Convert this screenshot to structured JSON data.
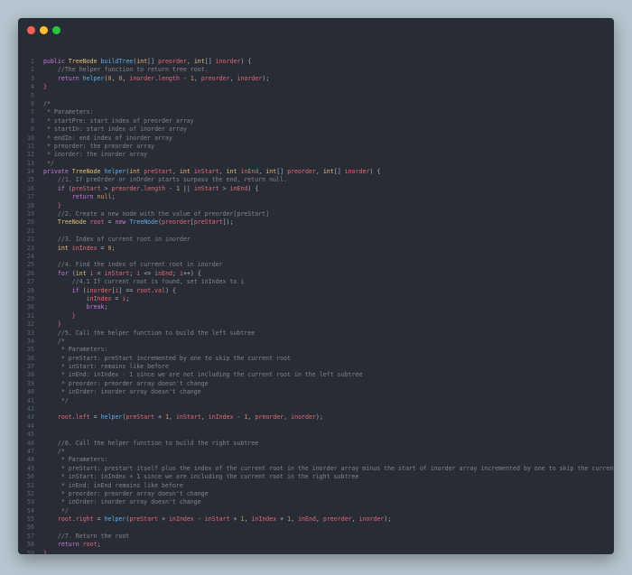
{
  "window": {
    "buttons": {
      "close_color": "#ff5f56",
      "minimize_color": "#ffbd2e",
      "maximize_color": "#27c93f"
    }
  },
  "editor": {
    "language": "java",
    "lines": [
      [
        [
          "kw",
          "public "
        ],
        [
          "ty",
          "TreeNode "
        ],
        [
          "fn",
          "buildTree"
        ],
        [
          "pl",
          "("
        ],
        [
          "ty",
          "int"
        ],
        [
          "pl",
          "[] "
        ],
        [
          "pa",
          "preorder"
        ],
        [
          "pl",
          ", "
        ],
        [
          "ty",
          "int"
        ],
        [
          "pl",
          "[] "
        ],
        [
          "pa",
          "inorder"
        ],
        [
          "pl",
          ") {"
        ]
      ],
      [
        [
          "cm",
          "    //The helper function to return tree root."
        ]
      ],
      [
        [
          "kw",
          "    return "
        ],
        [
          "fn",
          "helper"
        ],
        [
          "pl",
          "("
        ],
        [
          "nu",
          "0"
        ],
        [
          "pl",
          ", "
        ],
        [
          "nu",
          "0"
        ],
        [
          "pl",
          ", "
        ],
        [
          "pa",
          "inorder"
        ],
        [
          "pl",
          "."
        ],
        [
          "pa",
          "length"
        ],
        [
          "pl",
          " - "
        ],
        [
          "nu",
          "1"
        ],
        [
          "pl",
          ", "
        ],
        [
          "pa",
          "preorder"
        ],
        [
          "pl",
          ", "
        ],
        [
          "pa",
          "inorder"
        ],
        [
          "pl",
          ");"
        ]
      ],
      [
        [
          "pa",
          "}"
        ]
      ],
      [],
      [
        [
          "cm",
          "/*"
        ]
      ],
      [
        [
          "cm",
          " * Parameters:"
        ]
      ],
      [
        [
          "cm",
          " * startPre: start index of preorder array"
        ]
      ],
      [
        [
          "cm",
          " * startIn: start index of inorder array"
        ]
      ],
      [
        [
          "cm",
          " * endIn: end index of inorder array"
        ]
      ],
      [
        [
          "cm",
          " * preorder: the preorder array"
        ]
      ],
      [
        [
          "cm",
          " * inorder: the inorder array"
        ]
      ],
      [
        [
          "cm",
          " */"
        ]
      ],
      [
        [
          "kw",
          "private "
        ],
        [
          "ty",
          "TreeNode "
        ],
        [
          "fn",
          "helper"
        ],
        [
          "pl",
          "("
        ],
        [
          "ty",
          "int "
        ],
        [
          "pa",
          "preStart"
        ],
        [
          "pl",
          ", "
        ],
        [
          "ty",
          "int "
        ],
        [
          "pa",
          "inStart"
        ],
        [
          "pl",
          ", "
        ],
        [
          "ty",
          "int "
        ],
        [
          "pa",
          "inEnd"
        ],
        [
          "pl",
          ", "
        ],
        [
          "ty",
          "int"
        ],
        [
          "pl",
          "[] "
        ],
        [
          "pa",
          "preorder"
        ],
        [
          "pl",
          ", "
        ],
        [
          "ty",
          "int"
        ],
        [
          "pl",
          "[] "
        ],
        [
          "pa",
          "inorder"
        ],
        [
          "pl",
          ") {"
        ]
      ],
      [
        [
          "cm",
          "    //1. If preOrder or inOrder starts surpass the end, return null."
        ]
      ],
      [
        [
          "kw",
          "    if "
        ],
        [
          "pl",
          "("
        ],
        [
          "pa",
          "preStart"
        ],
        [
          "pl",
          " > "
        ],
        [
          "pa",
          "preorder"
        ],
        [
          "pl",
          "."
        ],
        [
          "pa",
          "length"
        ],
        [
          "pl",
          " - "
        ],
        [
          "nu",
          "1"
        ],
        [
          "pl",
          " || "
        ],
        [
          "pa",
          "inStart"
        ],
        [
          "pl",
          " > "
        ],
        [
          "pa",
          "inEnd"
        ],
        [
          "pl",
          ") {"
        ]
      ],
      [
        [
          "kw",
          "        return "
        ],
        [
          "nu",
          "null"
        ],
        [
          "pl",
          ";"
        ]
      ],
      [
        [
          "pa",
          "    }"
        ]
      ],
      [
        [
          "cm",
          "    //2. Create a new node with the value of preorder[preStart]"
        ]
      ],
      [
        [
          "ty",
          "    TreeNode "
        ],
        [
          "pa",
          "root"
        ],
        [
          "pl",
          " = "
        ],
        [
          "kw",
          "new "
        ],
        [
          "fn",
          "TreeNode"
        ],
        [
          "pl",
          "("
        ],
        [
          "pa",
          "preorder"
        ],
        [
          "pl",
          "["
        ],
        [
          "pa",
          "preStart"
        ],
        [
          "pl",
          "]);"
        ]
      ],
      [],
      [
        [
          "cm",
          "    //3. Index of current root in inorder"
        ]
      ],
      [
        [
          "ty",
          "    int "
        ],
        [
          "pa",
          "inIndex"
        ],
        [
          "pl",
          " = "
        ],
        [
          "nu",
          "0"
        ],
        [
          "pl",
          ";"
        ]
      ],
      [],
      [
        [
          "cm",
          "    //4. Find the index of current root in inorder"
        ]
      ],
      [
        [
          "kw",
          "    for "
        ],
        [
          "pl",
          "("
        ],
        [
          "ty",
          "int "
        ],
        [
          "pa",
          "i"
        ],
        [
          "pl",
          " = "
        ],
        [
          "pa",
          "inStart"
        ],
        [
          "pl",
          "; "
        ],
        [
          "pa",
          "i"
        ],
        [
          "pl",
          " <= "
        ],
        [
          "pa",
          "inEnd"
        ],
        [
          "pl",
          "; "
        ],
        [
          "pa",
          "i"
        ],
        [
          "pl",
          "++) {"
        ]
      ],
      [
        [
          "cm",
          "        //4.1 If current root is found, set inIndex to i"
        ]
      ],
      [
        [
          "kw",
          "        if "
        ],
        [
          "pl",
          "("
        ],
        [
          "pa",
          "inorder"
        ],
        [
          "pl",
          "["
        ],
        [
          "pa",
          "i"
        ],
        [
          "pl",
          "] == "
        ],
        [
          "pa",
          "root"
        ],
        [
          "pl",
          "."
        ],
        [
          "pa",
          "val"
        ],
        [
          "pl",
          ") {"
        ]
      ],
      [
        [
          "pa",
          "            inIndex"
        ],
        [
          "pl",
          " = "
        ],
        [
          "pa",
          "i"
        ],
        [
          "pl",
          ";"
        ]
      ],
      [
        [
          "kw",
          "            break"
        ],
        [
          "pl",
          ";"
        ]
      ],
      [
        [
          "pa",
          "        }"
        ]
      ],
      [
        [
          "pa",
          "    }"
        ]
      ],
      [
        [
          "cm",
          "    //5. Call the helper function to build the left subtree"
        ]
      ],
      [
        [
          "cm",
          "    /*"
        ]
      ],
      [
        [
          "cm",
          "     * Parameters:"
        ]
      ],
      [
        [
          "cm",
          "     * preStart: preStart incremented by one to skip the current root"
        ]
      ],
      [
        [
          "cm",
          "     * inStart: remains like before"
        ]
      ],
      [
        [
          "cm",
          "     * inEnd: inIndex - 1 since we are not including the current root in the left subtree"
        ]
      ],
      [
        [
          "cm",
          "     * preorder: preorder array doesn't change"
        ]
      ],
      [
        [
          "cm",
          "     * inOrder: inorder array doesn't change"
        ]
      ],
      [
        [
          "cm",
          "     */"
        ]
      ],
      [],
      [
        [
          "pa",
          "    root"
        ],
        [
          "pl",
          "."
        ],
        [
          "pa",
          "left"
        ],
        [
          "pl",
          " = "
        ],
        [
          "fn",
          "helper"
        ],
        [
          "pl",
          "("
        ],
        [
          "pa",
          "preStart"
        ],
        [
          "pl",
          " + "
        ],
        [
          "nu",
          "1"
        ],
        [
          "pl",
          ", "
        ],
        [
          "pa",
          "inStart"
        ],
        [
          "pl",
          ", "
        ],
        [
          "pa",
          "inIndex"
        ],
        [
          "pl",
          " - "
        ],
        [
          "nu",
          "1"
        ],
        [
          "pl",
          ", "
        ],
        [
          "pa",
          "preorder"
        ],
        [
          "pl",
          ", "
        ],
        [
          "pa",
          "inorder"
        ],
        [
          "pl",
          ");"
        ]
      ],
      [],
      [],
      [
        [
          "cm",
          "    //6. Call the helper function to build the right subtree"
        ]
      ],
      [
        [
          "cm",
          "    /*"
        ]
      ],
      [
        [
          "cm",
          "     * Parameters:"
        ]
      ],
      [
        [
          "cm",
          "     * preStart: prestart itself plus the index of the current root in the inorder array minus the start of inorder array incremented by one to skip the current root"
        ]
      ],
      [
        [
          "cm",
          "     * inStart: inIndex + 1 since we are including the current root in the right subtree"
        ]
      ],
      [
        [
          "cm",
          "     * inEnd: inEnd remains like before"
        ]
      ],
      [
        [
          "cm",
          "     * preorder: preorder array doesn't change"
        ]
      ],
      [
        [
          "cm",
          "     * inOrder: inorder array doesn't change"
        ]
      ],
      [
        [
          "cm",
          "     */"
        ]
      ],
      [
        [
          "pa",
          "    root"
        ],
        [
          "pl",
          "."
        ],
        [
          "pa",
          "right"
        ],
        [
          "pl",
          " = "
        ],
        [
          "fn",
          "helper"
        ],
        [
          "pl",
          "("
        ],
        [
          "pa",
          "preStart"
        ],
        [
          "pl",
          " + "
        ],
        [
          "pa",
          "inIndex"
        ],
        [
          "pl",
          " - "
        ],
        [
          "pa",
          "inStart"
        ],
        [
          "pl",
          " + "
        ],
        [
          "nu",
          "1"
        ],
        [
          "pl",
          ", "
        ],
        [
          "pa",
          "inIndex"
        ],
        [
          "pl",
          " + "
        ],
        [
          "nu",
          "1"
        ],
        [
          "pl",
          ", "
        ],
        [
          "pa",
          "inEnd"
        ],
        [
          "pl",
          ", "
        ],
        [
          "pa",
          "preorder"
        ],
        [
          "pl",
          ", "
        ],
        [
          "pa",
          "inorder"
        ],
        [
          "pl",
          ");"
        ]
      ],
      [],
      [
        [
          "cm",
          "    //7. Return the root"
        ]
      ],
      [
        [
          "kw",
          "    return "
        ],
        [
          "pa",
          "root"
        ],
        [
          "pl",
          ";"
        ]
      ],
      [
        [
          "pa",
          "}"
        ]
      ],
      []
    ]
  }
}
